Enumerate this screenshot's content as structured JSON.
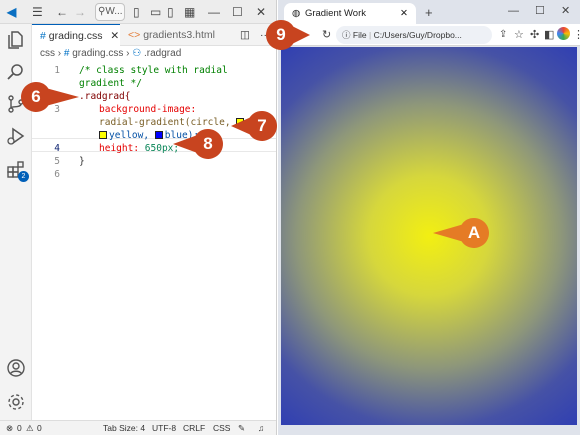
{
  "vscode": {
    "search_text": "W...",
    "tabs": [
      {
        "icon": "#",
        "label": "grading.css"
      },
      {
        "icon": "<>",
        "label": "gradients3.html"
      }
    ],
    "breadcrumb": {
      "folder": "css",
      "file": "grading.css",
      "symbol": ".radgrad"
    },
    "line_numbers": [
      "1",
      "2",
      "3",
      "4",
      "5",
      "6"
    ],
    "code": {
      "l1": "/* class style with radial",
      "l1b": "gradient */",
      "l2": ".radgrad{",
      "l3_prop": "background-image:",
      "l3_func": "radial-gradient(circle,",
      "l3_val1": "yellow,",
      "l3_val2": "blue);",
      "l4_prop": "height:",
      "l4_val": "650px;",
      "l5": "}"
    },
    "activity_badge": "2",
    "status": {
      "errors": "0",
      "warnings": "0",
      "tab_size": "Tab Size: 4",
      "encoding": "UTF-8",
      "eol": "CRLF",
      "language": "CSS"
    }
  },
  "browser": {
    "tab_title": "Gradient Work",
    "file_label": "File",
    "address": "C:/Users/Guy/Dropbo...",
    "new_tab": "+",
    "gradient_colors": [
      "yellow",
      "blue"
    ]
  },
  "callouts": [
    {
      "label": "6",
      "color": "#c8441f"
    },
    {
      "label": "7",
      "color": "#c8441f"
    },
    {
      "label": "8",
      "color": "#c8441f"
    },
    {
      "label": "9",
      "color": "#c8441f"
    },
    {
      "label": "A",
      "color": "#e57b25"
    }
  ]
}
